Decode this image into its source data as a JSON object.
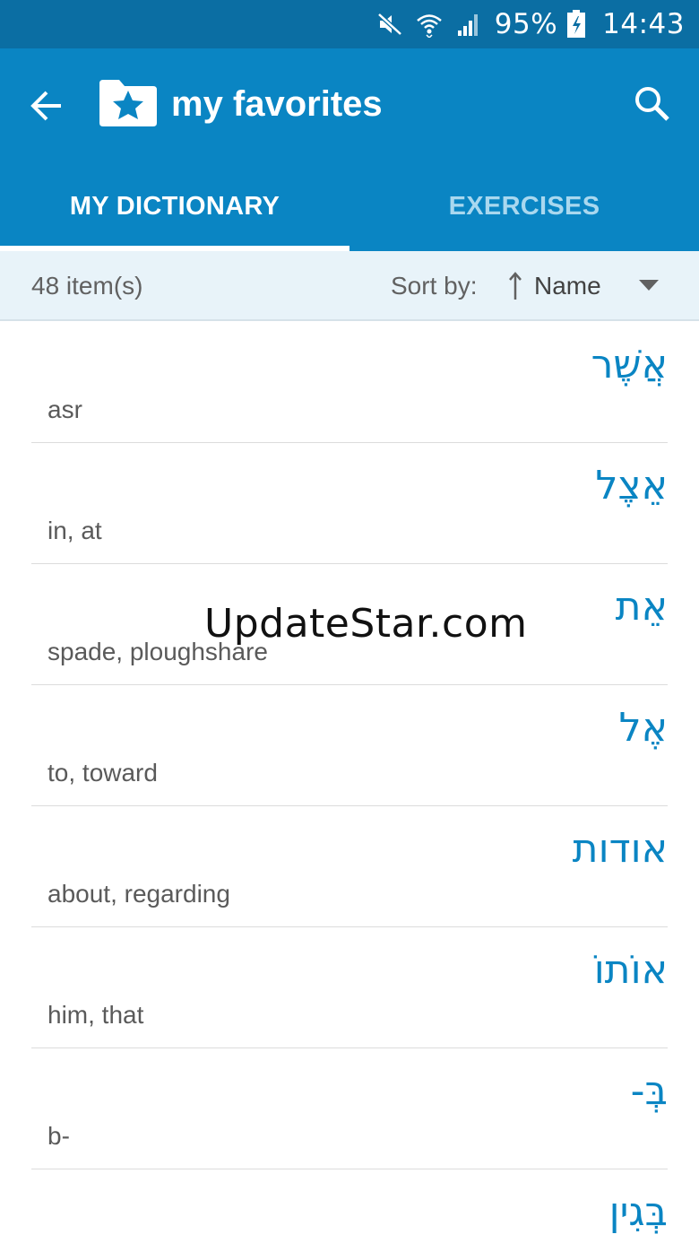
{
  "status_bar": {
    "icons": [
      "mute-icon",
      "wifi-icon",
      "signal-icon",
      "battery-charging-icon"
    ],
    "battery": "95%",
    "time": "14:43"
  },
  "app_bar": {
    "title": "my favorites",
    "back_icon": "arrow-left-icon",
    "title_icon": "folder-star-icon",
    "search_icon": "search-icon"
  },
  "tabs": [
    {
      "label": "MY DICTIONARY",
      "active": true
    },
    {
      "label": "EXERCISES",
      "active": false
    }
  ],
  "sort_bar": {
    "count": "48 item(s)",
    "sort_label": "Sort by:",
    "sort_value": "Name"
  },
  "entries": [
    {
      "hebrew": "אֲשֶׁר",
      "translation": "asr"
    },
    {
      "hebrew": "אֵצֶל",
      "translation": "in, at"
    },
    {
      "hebrew": "אֵת",
      "translation": "spade, ploughshare"
    },
    {
      "hebrew": "אֶל",
      "translation": "to, toward"
    },
    {
      "hebrew": "אודות",
      "translation": "about, regarding"
    },
    {
      "hebrew": "אוֹתוֹ",
      "translation": "him, that"
    },
    {
      "hebrew": "בְּ-",
      "translation": "b-"
    },
    {
      "hebrew": "בְּגִין",
      "translation": ""
    }
  ],
  "watermark": "UpdateStar.com",
  "colors": {
    "status_bar": "#0b6ea3",
    "app_bar": "#0a85c3",
    "sort_bar": "#e8f3f9",
    "hebrew_text": "#0a85c3"
  }
}
